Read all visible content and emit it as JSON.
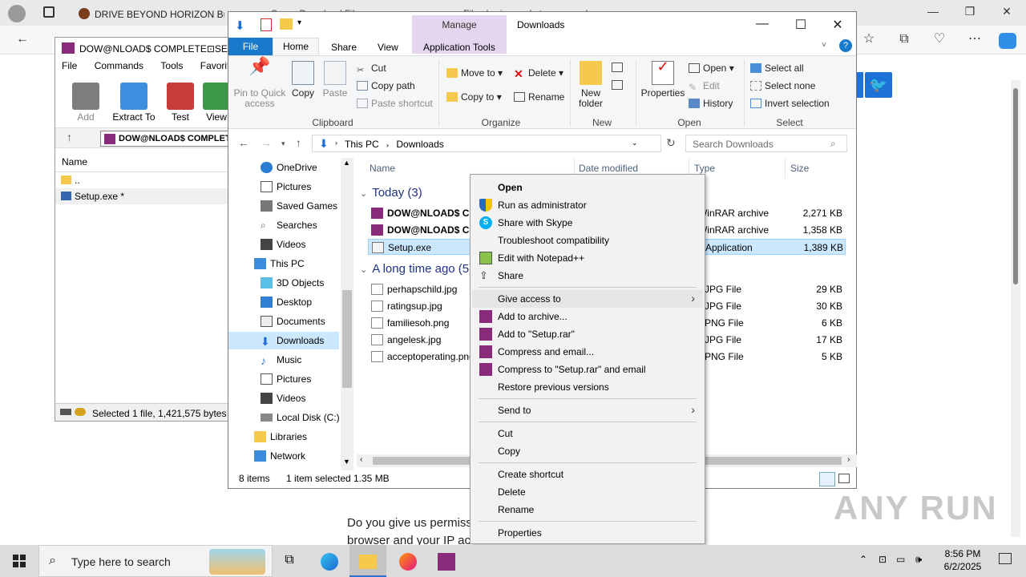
{
  "browser": {
    "tabs": [
      {
        "label": "DRIVE BEYOND HORIZON Bu"
      },
      {
        "label": "Super Download File"
      },
      {
        "label": "File sharing and storage made"
      }
    ],
    "watermark": "ANY RUN",
    "page_text": [
      "Do you give us permiss",
      "browser and your IP ac"
    ]
  },
  "winrar": {
    "title": "DOW@NLOAD$ COMPLETE⊡SETUP",
    "menu": [
      "File",
      "Commands",
      "Tools",
      "Favorites"
    ],
    "toolbar": [
      "Add",
      "Extract To",
      "Test",
      "View"
    ],
    "address": "DOW@NLOAD$ COMPLETE",
    "list_header": "Name",
    "rows": [
      {
        "name": ".."
      },
      {
        "name": "Setup.exe *"
      }
    ],
    "status": "Selected 1 file, 1,421,575 bytes"
  },
  "explorer": {
    "title": "Downloads",
    "manage_label": "Manage",
    "tabs": {
      "file": "File",
      "home": "Home",
      "share": "Share",
      "view": "View",
      "app_tools": "Application Tools"
    },
    "ribbon": {
      "pin": "Pin to Quick access",
      "copy": "Copy",
      "paste": "Paste",
      "cut": "Cut",
      "copy_path": "Copy path",
      "paste_shortcut": "Paste shortcut",
      "clipboard": "Clipboard",
      "move_to": "Move to",
      "copy_to": "Copy to",
      "delete": "Delete",
      "rename": "Rename",
      "organize": "Organize",
      "new_folder": "New folder",
      "new": "New",
      "properties": "Properties",
      "open": "Open",
      "edit": "Edit",
      "history": "History",
      "open_group": "Open",
      "select_all": "Select all",
      "select_none": "Select none",
      "invert_selection": "Invert selection",
      "select_group": "Select"
    },
    "breadcrumb": [
      "This PC",
      "Downloads"
    ],
    "search_placeholder": "Search Downloads",
    "tree": [
      "OneDrive",
      "Pictures",
      "Saved Games",
      "Searches",
      "Videos",
      "This PC",
      "3D Objects",
      "Desktop",
      "Documents",
      "Downloads",
      "Music",
      "Pictures",
      "Videos",
      "Local Disk (C:)",
      "Libraries",
      "Network"
    ],
    "columns": {
      "name": "Name",
      "date": "Date modified",
      "type": "Type",
      "size": "Size"
    },
    "groups": {
      "today": "Today (3)",
      "long_ago": "A long time ago (5)"
    },
    "files_today": [
      {
        "name": "DOW@NLOAD$ COMPLETE",
        "type": "WinRAR archive",
        "size": "2,271 KB"
      },
      {
        "name": "DOW@NLOAD$ COMPLETE",
        "type": "WinRAR archive",
        "size": "1,358 KB"
      },
      {
        "name": "Setup.exe",
        "type": "Application",
        "size": "1,389 KB"
      }
    ],
    "files_old": [
      {
        "name": "perhapschild.jpg",
        "type": "JPG File",
        "size": "29 KB"
      },
      {
        "name": "ratingsup.jpg",
        "type": "JPG File",
        "size": "30 KB"
      },
      {
        "name": "familiesoh.png",
        "type": "PNG File",
        "size": "6 KB"
      },
      {
        "name": "angelesk.jpg",
        "type": "JPG File",
        "size": "17 KB"
      },
      {
        "name": "acceptoperating.png",
        "type": "PNG File",
        "size": "5 KB"
      }
    ],
    "status": {
      "items": "8 items",
      "selected": "1 item selected",
      "size": "1.35 MB"
    }
  },
  "context_menu": {
    "open": "Open",
    "run_as_admin": "Run as administrator",
    "share_skype": "Share with Skype",
    "troubleshoot": "Troubleshoot compatibility",
    "notepad": "Edit with Notepad++",
    "share": "Share",
    "give_access": "Give access to",
    "add_archive": "Add to archive...",
    "add_setup_rar": "Add to \"Setup.rar\"",
    "compress_email": "Compress and email...",
    "compress_setup_email": "Compress to \"Setup.rar\" and email",
    "restore": "Restore previous versions",
    "send_to": "Send to",
    "cut": "Cut",
    "copy": "Copy",
    "create_shortcut": "Create shortcut",
    "delete": "Delete",
    "rename": "Rename",
    "properties": "Properties"
  },
  "taskbar": {
    "search_placeholder": "Type here to search",
    "time": "8:56 PM",
    "date": "6/2/2025"
  }
}
